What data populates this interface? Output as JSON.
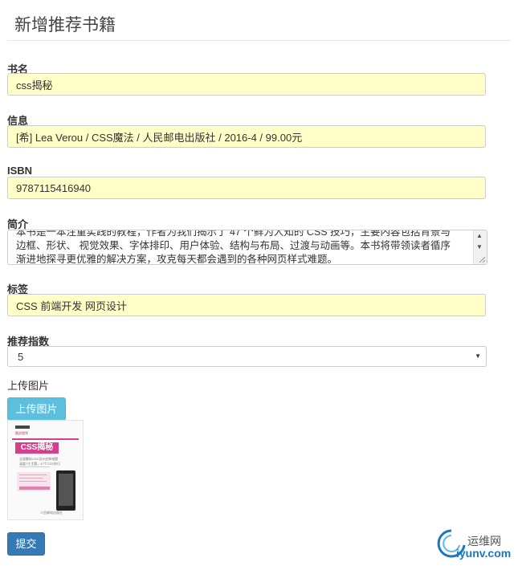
{
  "page": {
    "title": "新增推荐书籍"
  },
  "form": {
    "name": {
      "label": "书名",
      "value": "css揭秘"
    },
    "info": {
      "label": "信息",
      "value": "[希] Lea Verou / CSS魔法 / 人民邮电出版社 / 2016-4 / 99.00元"
    },
    "isbn": {
      "label": "ISBN",
      "value": "9787115416940"
    },
    "intro": {
      "label": "简介",
      "lines": [
        "本书是一本注重实践的教程，作者为我们揭示了 47 个鲜为人知的 CSS 技巧，主要内容包括背景与",
        "边框、形状、 视觉效果、字体排印、用户体验、结构与布局、过渡与动画等。本书将带领读者循序",
        "渐进地探寻更优雅的解决方案，攻克每天都会遇到的各种网页样式难题。"
      ]
    },
    "tags": {
      "label": "标签",
      "value": "CSS 前端开发 网页设计"
    },
    "rating": {
      "label": "推荐指数",
      "value": "5"
    },
    "upload": {
      "label": "上传图片",
      "button": "上传图片"
    },
    "submit": {
      "label": "提交"
    }
  },
  "cover": {
    "title": "CSS揭秘",
    "badge": "图灵程序",
    "subtitle1": "全面解析CSS设计经典难题",
    "subtitle2": "涵盖7大主题，47个CSS技巧",
    "publisher": "人民邮电出版社",
    "accent": "#d53f8c"
  },
  "watermark": {
    "text1": "运维网",
    "text2": "iyunv.com",
    "color": "#1a78c2"
  },
  "colors": {
    "input_bg": "#ffffc8",
    "upload_btn": "#5bc0de",
    "submit_btn": "#337ab7"
  }
}
